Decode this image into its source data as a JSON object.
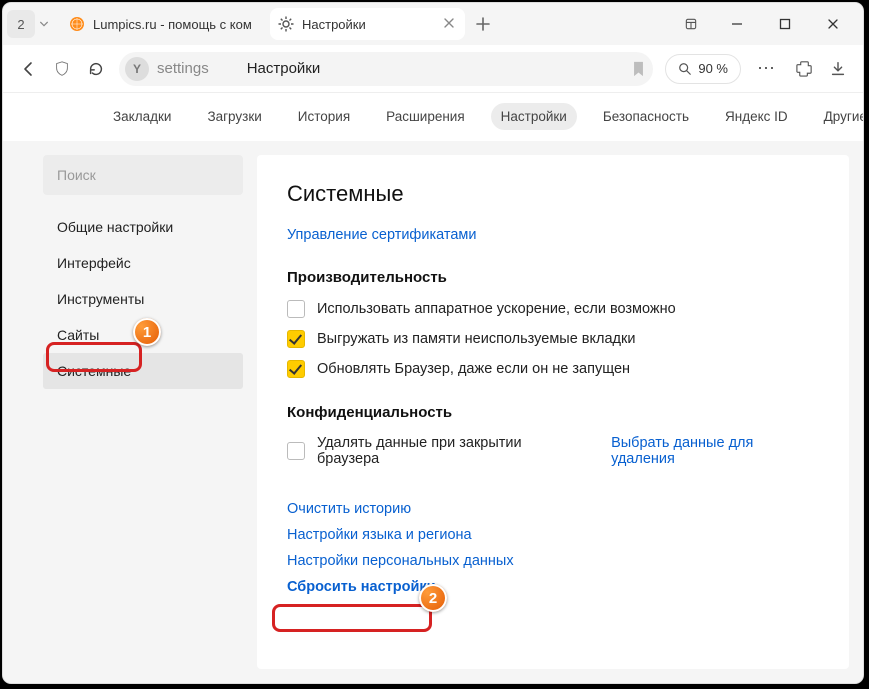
{
  "window": {
    "tab_counter": "2",
    "tabs": [
      {
        "title": "Lumpics.ru - помощь с ком",
        "favicon": "orange-circle",
        "active": false
      },
      {
        "title": "Настройки",
        "favicon": "gear",
        "active": true
      }
    ]
  },
  "address": {
    "site_icon_letter": "Y",
    "url_text": "settings",
    "page_title": "Настройки",
    "zoom_label": "90 %"
  },
  "subnav": {
    "items": [
      "Закладки",
      "Загрузки",
      "История",
      "Расширения",
      "Настройки",
      "Безопасность",
      "Яндекс ID",
      "Другие устройства"
    ],
    "active_index": 4
  },
  "sidebar": {
    "search_placeholder": "Поиск",
    "items": [
      "Общие настройки",
      "Интерфейс",
      "Инструменты",
      "Сайты",
      "Системные"
    ],
    "active_index": 4
  },
  "content": {
    "heading": "Системные",
    "cert_link": "Управление сертификатами",
    "perf_title": "Производительность",
    "perf_options": [
      {
        "label": "Использовать аппаратное ускорение, если возможно",
        "checked": false
      },
      {
        "label": "Выгружать из памяти неиспользуемые вкладки",
        "checked": true
      },
      {
        "label": "Обновлять Браузер, даже если он не запущен",
        "checked": true
      }
    ],
    "privacy_title": "Конфиденциальность",
    "privacy_option": {
      "label": "Удалять данные при закрытии браузера",
      "checked": false
    },
    "privacy_inline_link": "Выбрать данные для удаления",
    "links": [
      "Очистить историю",
      "Настройки языка и региона",
      "Настройки персональных данных",
      "Сбросить настройки"
    ]
  },
  "annotations": {
    "badge1": "1",
    "badge2": "2"
  }
}
